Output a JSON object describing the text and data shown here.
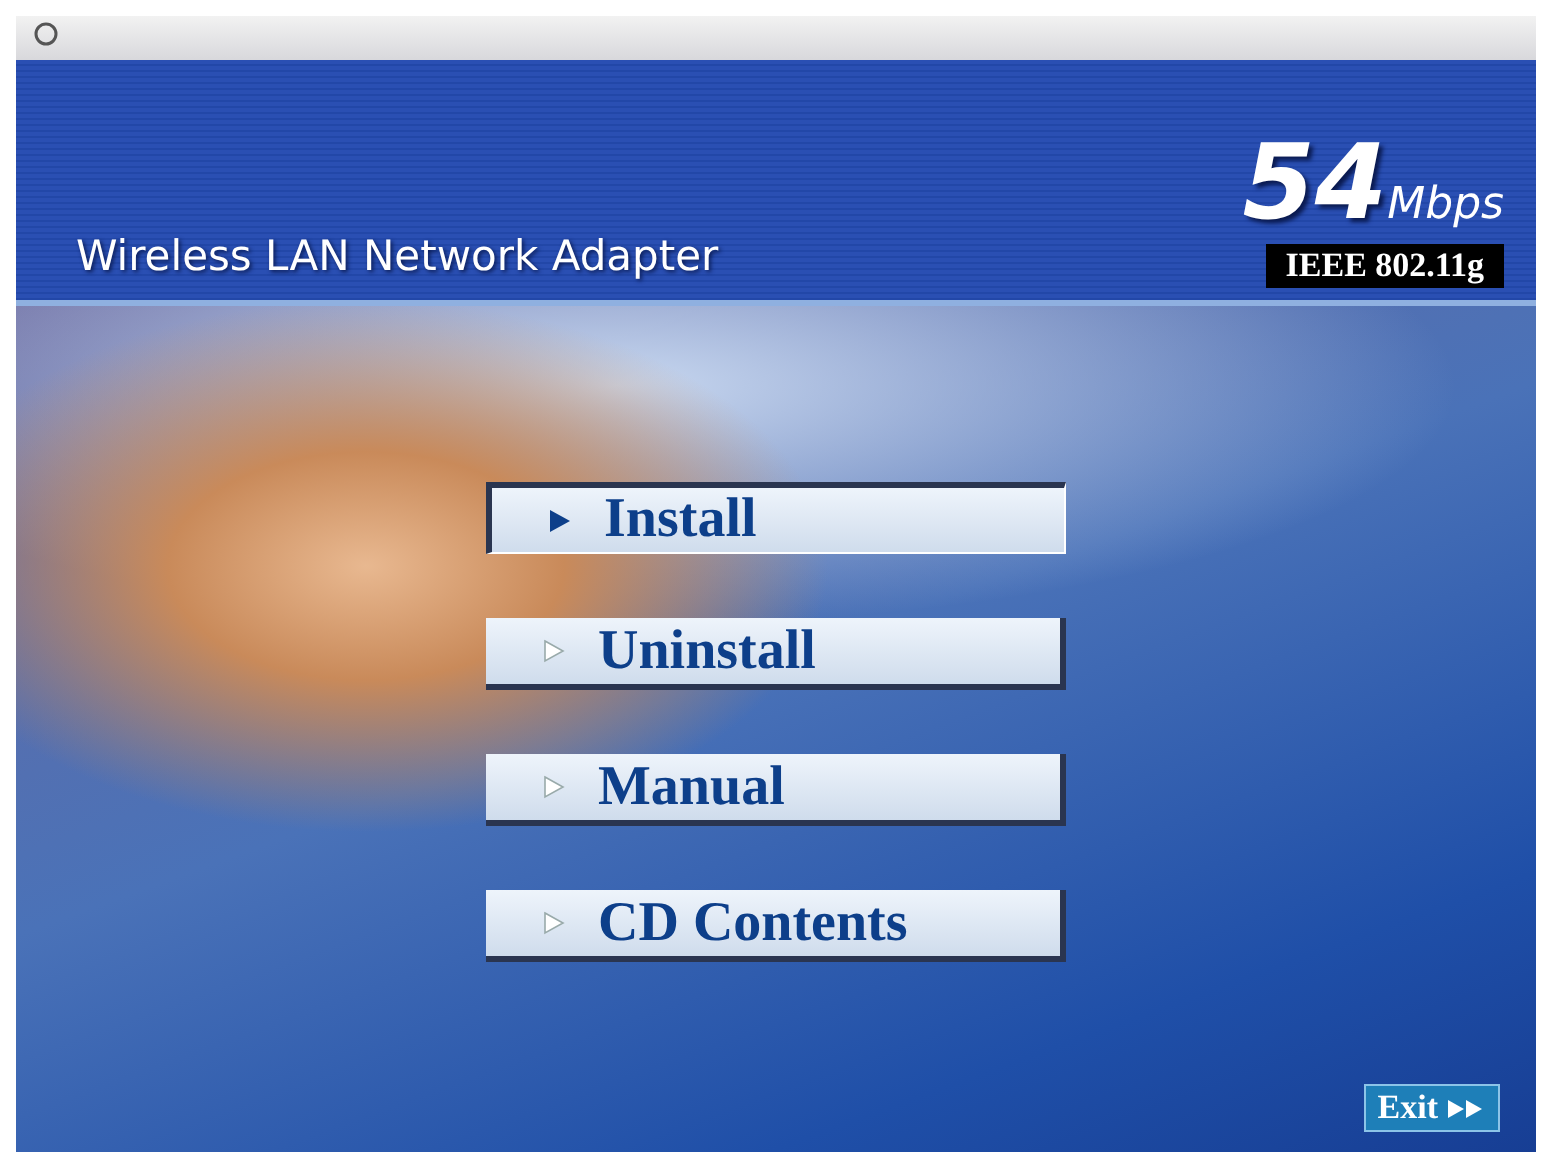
{
  "header": {
    "title": "Wireless LAN Network Adapter",
    "speed_number": "54",
    "speed_unit": "Mbps",
    "standard": "IEEE 802.11g"
  },
  "menu": [
    {
      "label": "Install",
      "selected": true
    },
    {
      "label": "Uninstall",
      "selected": false
    },
    {
      "label": "Manual",
      "selected": false
    },
    {
      "label": "CD Contents",
      "selected": false
    }
  ],
  "exit_button": {
    "label": "Exit"
  }
}
